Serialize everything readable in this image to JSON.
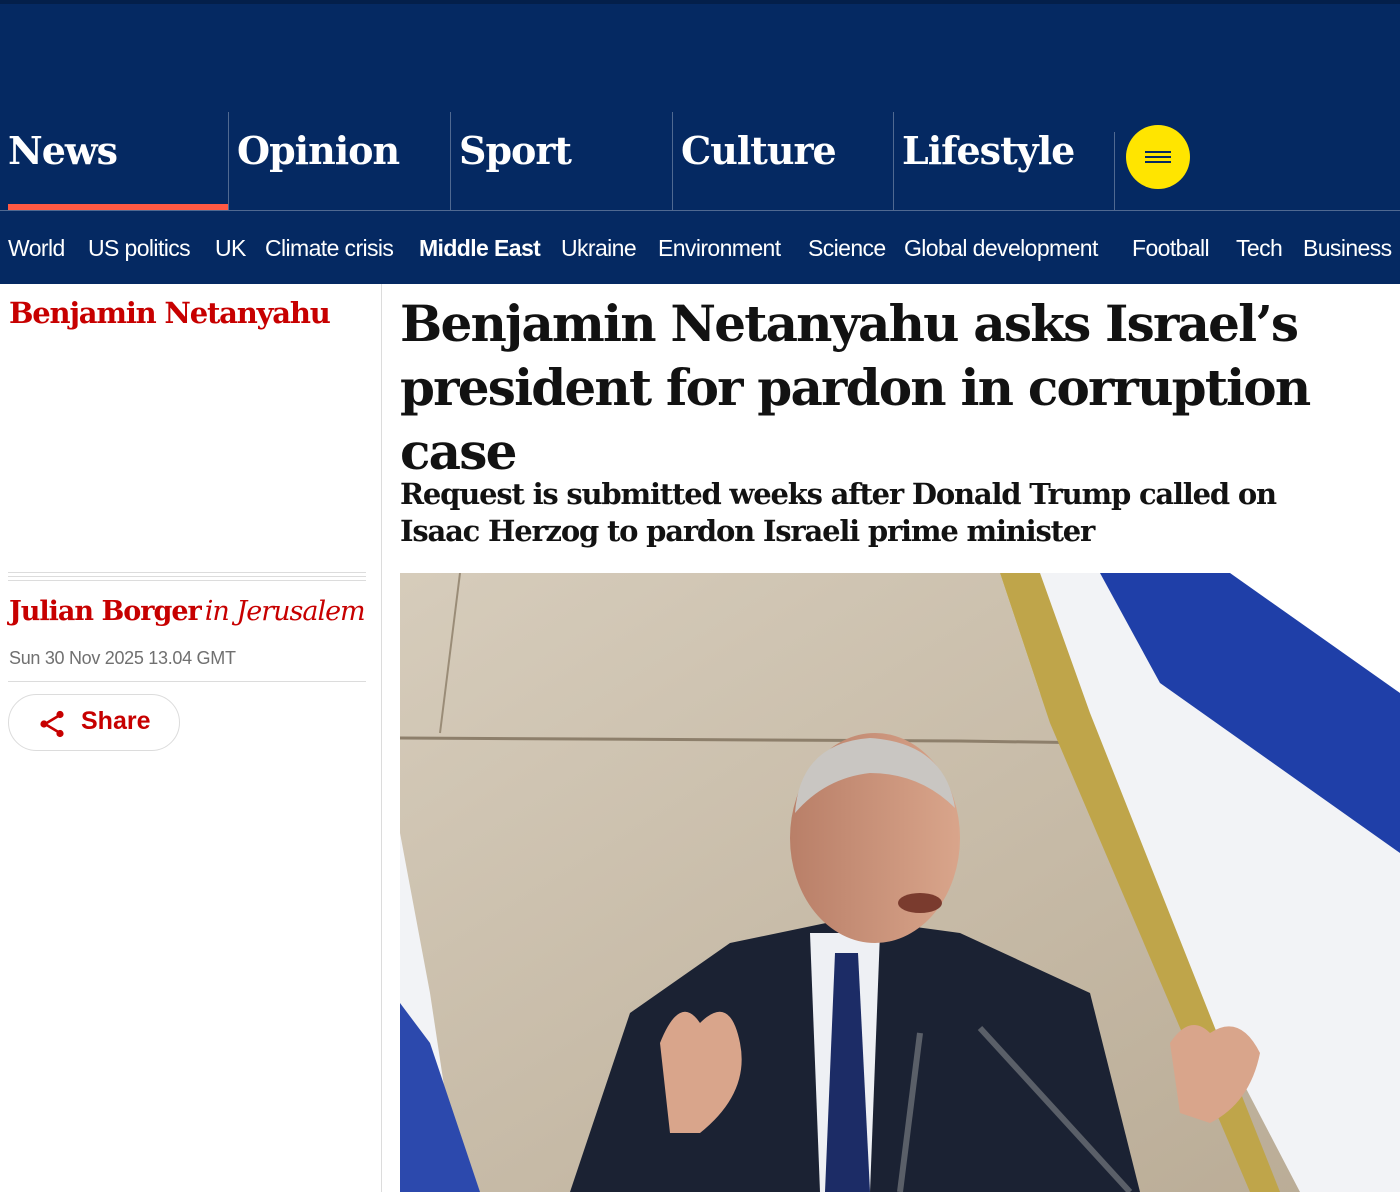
{
  "nav": {
    "pillars": [
      "News",
      "Opinion",
      "Sport",
      "Culture",
      "Lifestyle"
    ],
    "active_pillar": "News",
    "menu_icon": "hamburger-icon",
    "sections": [
      "World",
      "US politics",
      "UK",
      "Climate crisis",
      "Middle East",
      "Ukraine",
      "Environment",
      "Science",
      "Global development",
      "Football",
      "Tech",
      "Business"
    ],
    "current_section": "Middle East"
  },
  "article": {
    "series": "Benjamin Netanyahu",
    "byline": {
      "author": "Julian Borger",
      "location": "in Jerusalem"
    },
    "date": "Sun 30 Nov 2025 13.04 GMT",
    "share_label": "Share",
    "share_icon": "share-icon",
    "headline": "Benjamin Netanyahu asks Israel’s president for pardon in corruption case",
    "standfirst": "Request is submitted weeks after Donald Trump called on Isaac Herzog to pardon Israeli prime minister"
  },
  "colors": {
    "brand_blue": "#052962",
    "news_red": "#c70000",
    "active_underline": "#ff5943",
    "menu_yellow": "#ffe500"
  }
}
